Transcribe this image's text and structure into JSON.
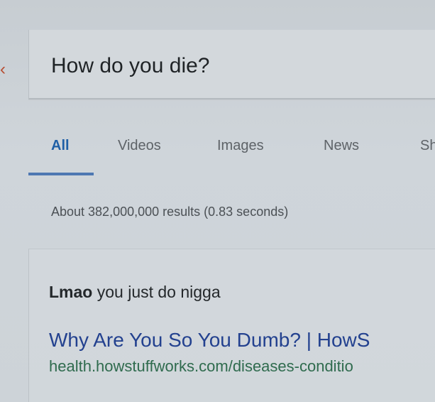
{
  "search": {
    "query": "How do you die?"
  },
  "tabs": [
    {
      "label": "All",
      "active": true
    },
    {
      "label": "Videos"
    },
    {
      "label": "Images"
    },
    {
      "label": "News"
    },
    {
      "label": "Sh"
    }
  ],
  "results_stats": "About 382,000,000 results (0.83 seconds)",
  "featured_snippet": {
    "bold": "Lmao",
    "text": " you just do nigga"
  },
  "first_result": {
    "title": "Why Are You So You Dumb? | HowS",
    "url": "health.howstuffworks.com/diseases-conditio"
  },
  "colors": {
    "tab_active": "#1f5fa6",
    "tab_underline": "#4e78b2",
    "title": "#23418f",
    "url": "#2f6b4e"
  }
}
